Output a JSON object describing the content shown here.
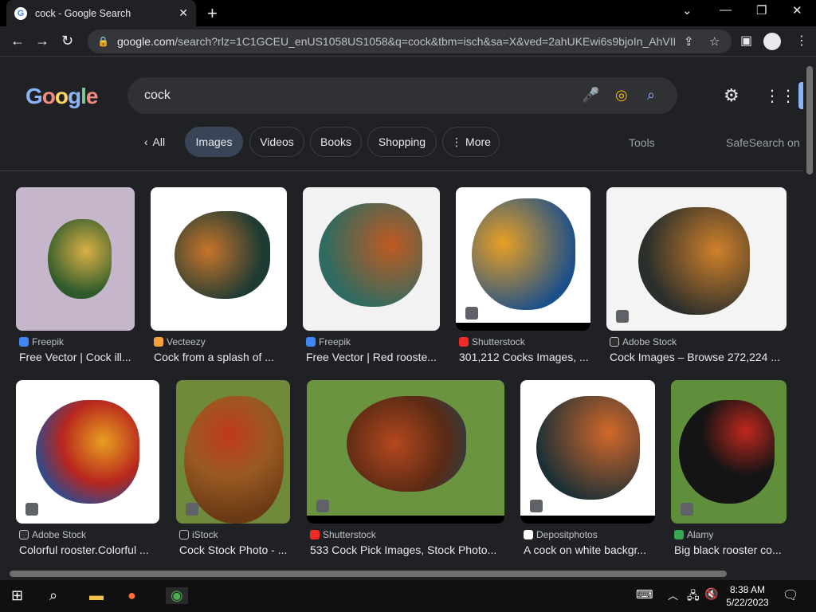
{
  "browser": {
    "tab_title": "cock - Google Search",
    "url_domain": "google.com",
    "url_rest": "/search?rlz=1C1GCEU_enUS1058US1058&q=cock&tbm=isch&sa=X&ved=2ahUKEwi6s9bjoIn_AhVIF..."
  },
  "search": {
    "query": "cock"
  },
  "chips": [
    {
      "label": "All"
    },
    {
      "label": "Images",
      "active": true
    },
    {
      "label": "Videos"
    },
    {
      "label": "Books"
    },
    {
      "label": "Shopping"
    },
    {
      "label": "More"
    }
  ],
  "tools_label": "Tools",
  "safesearch_label": "SafeSearch on",
  "results": [
    {
      "source": "Freepik",
      "caption": "Free Vector | Cock ill...",
      "src_color": "#4285f4",
      "bg": "#c5b6cc"
    },
    {
      "source": "Vecteezy",
      "caption": "Cock from a splash of ...",
      "src_color": "#f6a23c",
      "bg": "#ffffff"
    },
    {
      "source": "Freepik",
      "caption": "Free Vector | Red rooste...",
      "src_color": "#4285f4",
      "bg": "#f2f2f2"
    },
    {
      "source": "Shutterstock",
      "caption": "301,212 Cocks Images, ...",
      "src_color": "#ee2b24",
      "bg": "#ffffff"
    },
    {
      "source": "Adobe Stock",
      "caption": "Cock Images – Browse 272,224 ...",
      "src_color": "#303030",
      "bg": "#f4f4f4"
    },
    {
      "source": "Adobe Stock",
      "caption": "Colorful rooster.Colorful ...",
      "src_color": "#303030",
      "bg": "#ffffff"
    },
    {
      "source": "iStock",
      "caption": "Cock Stock Photo - ...",
      "src_color": "#202124",
      "bg": "#6f8a3a"
    },
    {
      "source": "Shutterstock",
      "caption": "533 Cock Pick Images, Stock Photo...",
      "src_color": "#ee2b24",
      "bg": "#6a9440"
    },
    {
      "source": "Depositphotos",
      "caption": "A cock on white backgr...",
      "src_color": "#ffffff",
      "bg": "#ffffff"
    },
    {
      "source": "Alamy",
      "caption": "Big black rooster co...",
      "src_color": "#34a853",
      "bg": "#5f8f3a"
    }
  ],
  "taskbar": {
    "time": "8:38 AM",
    "date": "5/22/2023"
  }
}
